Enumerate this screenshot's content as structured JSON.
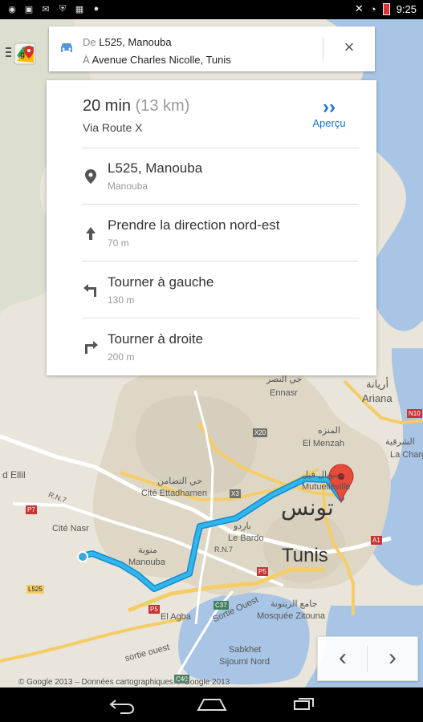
{
  "status_bar": {
    "time": "9:25",
    "left_icons": [
      "location-icon",
      "image-icon",
      "mail-icon",
      "shield-icon",
      "apps-icon",
      "android-icon"
    ],
    "right_icons": [
      "mute-icon",
      "wifi-icon",
      "battery-icon"
    ]
  },
  "route": {
    "from_prefix": "De",
    "from_value": "L525, Manouba",
    "to_prefix": "À",
    "to_value": "Avenue Charles Nicolle, Tunis"
  },
  "summary": {
    "duration": "20 min",
    "distance": "(13 km)",
    "via": "Via Route X",
    "preview_label": "Aperçu"
  },
  "steps": [
    {
      "title": "L525, Manouba",
      "subtitle": "Manouba",
      "icon": "location-pin-icon"
    },
    {
      "title": "Prendre la direction nord-est",
      "subtitle": "70 m",
      "icon": "arrow-up-icon"
    },
    {
      "title": "Tourner à gauche",
      "subtitle": "130 m",
      "icon": "turn-left-icon"
    },
    {
      "title": "Tourner à droite",
      "subtitle": "200 m",
      "icon": "turn-right-icon"
    }
  ],
  "map": {
    "labels": {
      "ariana": "Ariana",
      "menzah": "El Menzah",
      "ennasr": "Ennasr",
      "ettadhamen": "Cité Ettadhamen",
      "nasr": "Cité Nasr",
      "manouba": "Manouba",
      "elagba": "El Agba",
      "lebardo": "Le Bardo",
      "mutuelle": "Mutuelleville",
      "lacharguia": "La Chargui",
      "mosque": "Mosquée Zitouna",
      "sebkhet": "Sabkhet",
      "sijoumi": "Sijoumi Nord",
      "sortie_ouest": "Sortie Ouest",
      "sortie_ouest_lower": "sortie ouest",
      "dellil": "d Ellil",
      "rn7": "R.N.7",
      "rn7b": "R.N.7",
      "x20": "X20",
      "x3": "X3",
      "n10": "N10",
      "l525": "L525",
      "p7": "P7",
      "p5": "P5",
      "p5b": "P5",
      "c37": "C37",
      "c40": "C40",
      "a1": "A1",
      "tunis_ar": "تونس",
      "tunis": "Tunis",
      "ariana_ar": "أريانة",
      "ettadhamen_ar": "حي التضامن",
      "manouba_ar": "منوبة",
      "zitouna_ar": "جامع الزيتونة",
      "menzah_ar": "المنزه",
      "charguia_ar": "الشرقية",
      "ennasr_ar": "حي النصر",
      "mutuelle_ar": "ميتويال فيل",
      "bardo_ar": "باردو"
    },
    "copyright": "© Google 2013 – Données cartographiques © Google 2013"
  },
  "controls": {
    "prev": "‹",
    "next": "›",
    "close": "×"
  },
  "colors": {
    "route_line": "#30b6ea",
    "accent": "#1a73c8",
    "destination_pin": "#e74b3c"
  }
}
